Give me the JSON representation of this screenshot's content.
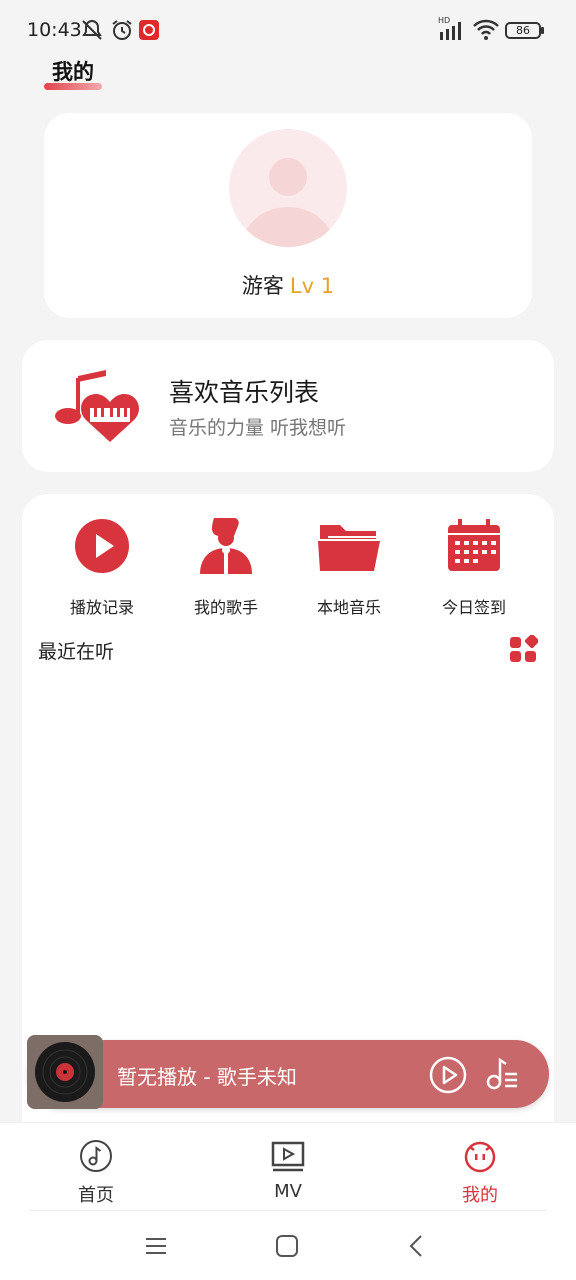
{
  "status_bar": {
    "time": "10:43",
    "battery": "86",
    "network_label": "HD"
  },
  "header": {
    "title": "我的"
  },
  "profile": {
    "user_name": "游客",
    "level": "Lv 1"
  },
  "favorites": {
    "title": "喜欢音乐列表",
    "subtitle": "音乐的力量 听我想听"
  },
  "quick_actions": [
    {
      "label": "播放记录",
      "icon": "play-circle-icon"
    },
    {
      "label": "我的歌手",
      "icon": "singer-icon"
    },
    {
      "label": "本地音乐",
      "icon": "folder-icon"
    },
    {
      "label": "今日签到",
      "icon": "calendar-icon"
    }
  ],
  "recent": {
    "title": "最近在听"
  },
  "player": {
    "now_playing": "暂无播放 - 歌手未知"
  },
  "bottom_nav": {
    "items": [
      {
        "label": "首页",
        "icon": "music-note-icon"
      },
      {
        "label": "MV",
        "icon": "video-icon"
      },
      {
        "label": "我的",
        "icon": "face-icon",
        "active": true
      }
    ]
  },
  "colors": {
    "accent": "#d8343e",
    "player_bg": "#c9686a",
    "level": "#e8a227"
  }
}
